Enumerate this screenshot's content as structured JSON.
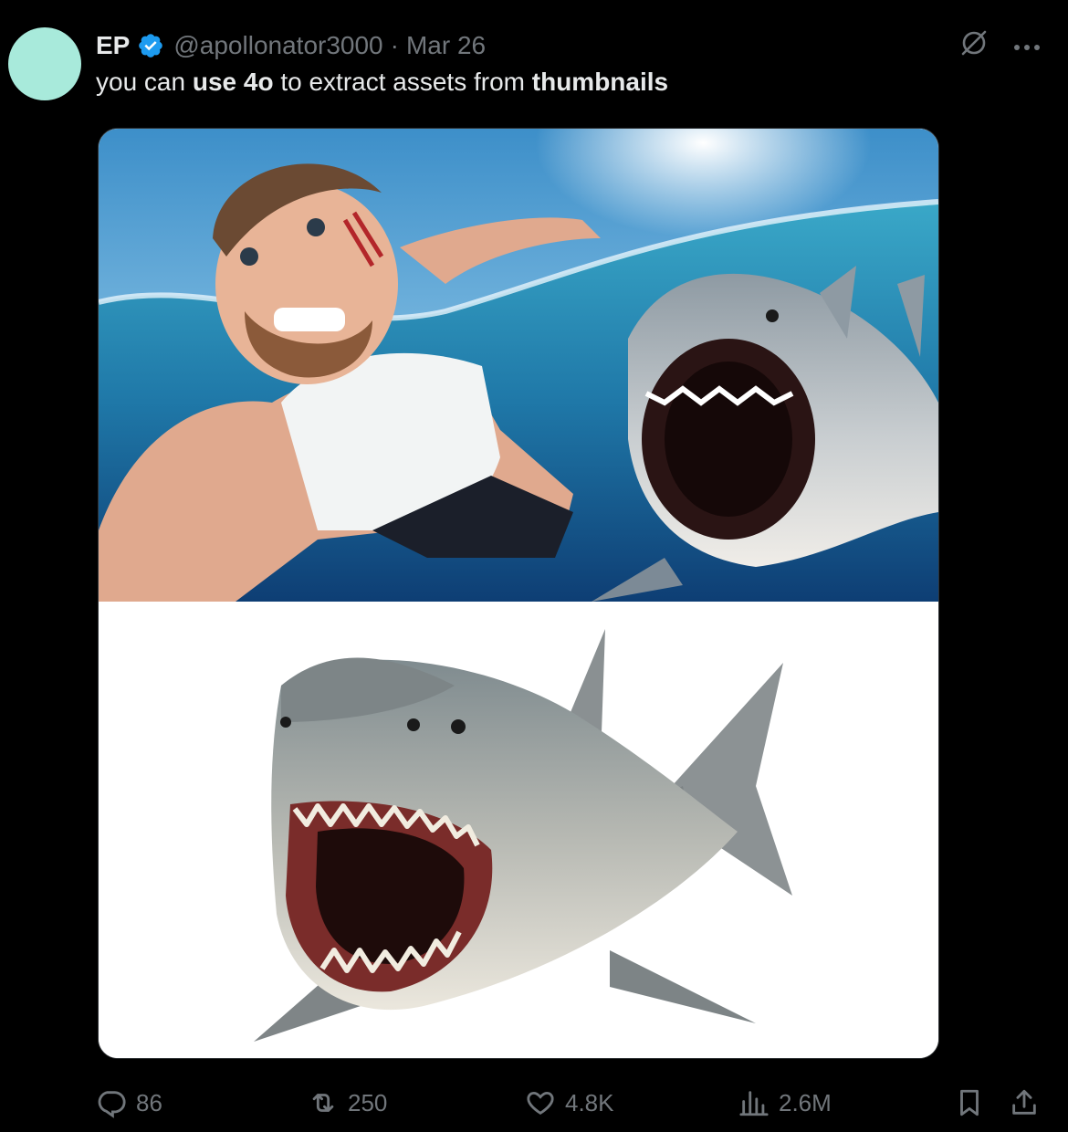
{
  "tweet": {
    "author_name": "EP",
    "handle": "@apollonator3000",
    "separator": "·",
    "date": "Mar 26",
    "text_parts": [
      {
        "text": "you can ",
        "bold": false
      },
      {
        "text": "use 4o",
        "bold": true
      },
      {
        "text": " to extract assets from ",
        "bold": false
      },
      {
        "text": "thumbnails",
        "bold": true
      }
    ],
    "avatar_color": "#a8eadb"
  },
  "media": {
    "top_image_description_icon": "shark-attack-thumbnail-image",
    "bottom_image_description_icon": "extracted-shark-image"
  },
  "actions": {
    "replies": "86",
    "reposts": "250",
    "likes": "4.8K",
    "views": "2.6M"
  },
  "colors": {
    "background": "#000000",
    "text": "#e7e9ea",
    "muted": "#71767b",
    "verified": "#1d9bf0"
  }
}
